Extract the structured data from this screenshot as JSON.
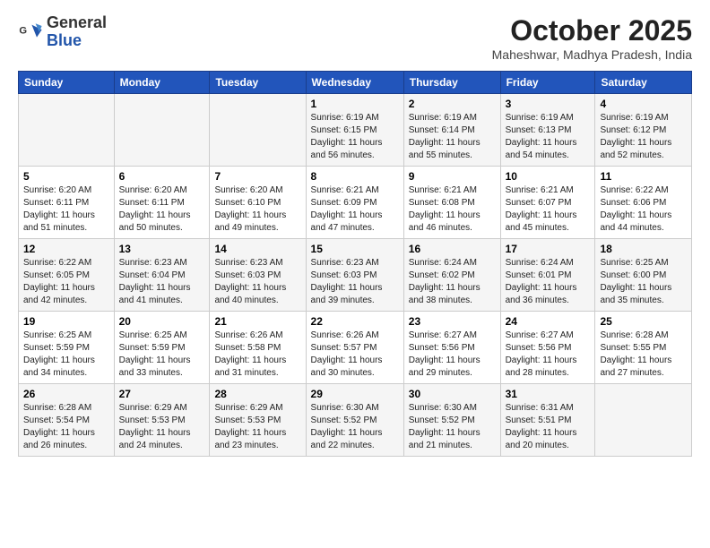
{
  "header": {
    "logo_general": "General",
    "logo_blue": "Blue",
    "month_title": "October 2025",
    "location": "Maheshwar, Madhya Pradesh, India"
  },
  "weekdays": [
    "Sunday",
    "Monday",
    "Tuesday",
    "Wednesday",
    "Thursday",
    "Friday",
    "Saturday"
  ],
  "weeks": [
    [
      {
        "day": "",
        "info": ""
      },
      {
        "day": "",
        "info": ""
      },
      {
        "day": "",
        "info": ""
      },
      {
        "day": "1",
        "info": "Sunrise: 6:19 AM\nSunset: 6:15 PM\nDaylight: 11 hours and 56 minutes."
      },
      {
        "day": "2",
        "info": "Sunrise: 6:19 AM\nSunset: 6:14 PM\nDaylight: 11 hours and 55 minutes."
      },
      {
        "day": "3",
        "info": "Sunrise: 6:19 AM\nSunset: 6:13 PM\nDaylight: 11 hours and 54 minutes."
      },
      {
        "day": "4",
        "info": "Sunrise: 6:19 AM\nSunset: 6:12 PM\nDaylight: 11 hours and 52 minutes."
      }
    ],
    [
      {
        "day": "5",
        "info": "Sunrise: 6:20 AM\nSunset: 6:11 PM\nDaylight: 11 hours and 51 minutes."
      },
      {
        "day": "6",
        "info": "Sunrise: 6:20 AM\nSunset: 6:11 PM\nDaylight: 11 hours and 50 minutes."
      },
      {
        "day": "7",
        "info": "Sunrise: 6:20 AM\nSunset: 6:10 PM\nDaylight: 11 hours and 49 minutes."
      },
      {
        "day": "8",
        "info": "Sunrise: 6:21 AM\nSunset: 6:09 PM\nDaylight: 11 hours and 47 minutes."
      },
      {
        "day": "9",
        "info": "Sunrise: 6:21 AM\nSunset: 6:08 PM\nDaylight: 11 hours and 46 minutes."
      },
      {
        "day": "10",
        "info": "Sunrise: 6:21 AM\nSunset: 6:07 PM\nDaylight: 11 hours and 45 minutes."
      },
      {
        "day": "11",
        "info": "Sunrise: 6:22 AM\nSunset: 6:06 PM\nDaylight: 11 hours and 44 minutes."
      }
    ],
    [
      {
        "day": "12",
        "info": "Sunrise: 6:22 AM\nSunset: 6:05 PM\nDaylight: 11 hours and 42 minutes."
      },
      {
        "day": "13",
        "info": "Sunrise: 6:23 AM\nSunset: 6:04 PM\nDaylight: 11 hours and 41 minutes."
      },
      {
        "day": "14",
        "info": "Sunrise: 6:23 AM\nSunset: 6:03 PM\nDaylight: 11 hours and 40 minutes."
      },
      {
        "day": "15",
        "info": "Sunrise: 6:23 AM\nSunset: 6:03 PM\nDaylight: 11 hours and 39 minutes."
      },
      {
        "day": "16",
        "info": "Sunrise: 6:24 AM\nSunset: 6:02 PM\nDaylight: 11 hours and 38 minutes."
      },
      {
        "day": "17",
        "info": "Sunrise: 6:24 AM\nSunset: 6:01 PM\nDaylight: 11 hours and 36 minutes."
      },
      {
        "day": "18",
        "info": "Sunrise: 6:25 AM\nSunset: 6:00 PM\nDaylight: 11 hours and 35 minutes."
      }
    ],
    [
      {
        "day": "19",
        "info": "Sunrise: 6:25 AM\nSunset: 5:59 PM\nDaylight: 11 hours and 34 minutes."
      },
      {
        "day": "20",
        "info": "Sunrise: 6:25 AM\nSunset: 5:59 PM\nDaylight: 11 hours and 33 minutes."
      },
      {
        "day": "21",
        "info": "Sunrise: 6:26 AM\nSunset: 5:58 PM\nDaylight: 11 hours and 31 minutes."
      },
      {
        "day": "22",
        "info": "Sunrise: 6:26 AM\nSunset: 5:57 PM\nDaylight: 11 hours and 30 minutes."
      },
      {
        "day": "23",
        "info": "Sunrise: 6:27 AM\nSunset: 5:56 PM\nDaylight: 11 hours and 29 minutes."
      },
      {
        "day": "24",
        "info": "Sunrise: 6:27 AM\nSunset: 5:56 PM\nDaylight: 11 hours and 28 minutes."
      },
      {
        "day": "25",
        "info": "Sunrise: 6:28 AM\nSunset: 5:55 PM\nDaylight: 11 hours and 27 minutes."
      }
    ],
    [
      {
        "day": "26",
        "info": "Sunrise: 6:28 AM\nSunset: 5:54 PM\nDaylight: 11 hours and 26 minutes."
      },
      {
        "day": "27",
        "info": "Sunrise: 6:29 AM\nSunset: 5:53 PM\nDaylight: 11 hours and 24 minutes."
      },
      {
        "day": "28",
        "info": "Sunrise: 6:29 AM\nSunset: 5:53 PM\nDaylight: 11 hours and 23 minutes."
      },
      {
        "day": "29",
        "info": "Sunrise: 6:30 AM\nSunset: 5:52 PM\nDaylight: 11 hours and 22 minutes."
      },
      {
        "day": "30",
        "info": "Sunrise: 6:30 AM\nSunset: 5:52 PM\nDaylight: 11 hours and 21 minutes."
      },
      {
        "day": "31",
        "info": "Sunrise: 6:31 AM\nSunset: 5:51 PM\nDaylight: 11 hours and 20 minutes."
      },
      {
        "day": "",
        "info": ""
      }
    ]
  ]
}
